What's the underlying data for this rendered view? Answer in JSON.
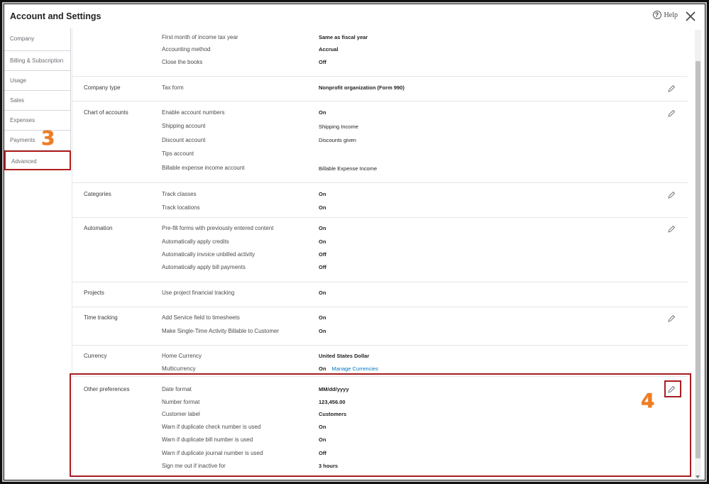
{
  "window": {
    "title": "Account and Settings",
    "help_label": "Help"
  },
  "sidebar": {
    "items": [
      {
        "label": "Company"
      },
      {
        "label": "Billing & Subscription"
      },
      {
        "label": "Usage"
      },
      {
        "label": "Sales"
      },
      {
        "label": "Expenses"
      },
      {
        "label": "Payments"
      },
      {
        "label": "Advanced",
        "selected": true
      }
    ]
  },
  "annotations": {
    "step3": "3",
    "step4": "4"
  },
  "sections": {
    "accounting": {
      "rows": [
        {
          "label": "First month of income tax year",
          "value": "Same as fiscal year"
        },
        {
          "label": "Accounting method",
          "value": "Accrual"
        },
        {
          "label": "Close the books",
          "value": "Off"
        }
      ]
    },
    "company_type": {
      "title": "Company type",
      "rows": [
        {
          "label": "Tax form",
          "value": "Nonprofit organization (Form 990)"
        }
      ]
    },
    "chart_of_accounts": {
      "title": "Chart of accounts",
      "rows": [
        {
          "label": "Enable account numbers",
          "value": "On"
        },
        {
          "label": "Shipping account",
          "value": "Shipping Income"
        },
        {
          "label": "Discount account",
          "value": "Discounts given"
        },
        {
          "label": "Tips account",
          "value": ""
        },
        {
          "label": "Billable expense income account",
          "value": "Billable Expense Income"
        }
      ]
    },
    "categories": {
      "title": "Categories",
      "rows": [
        {
          "label": "Track classes",
          "value": "On"
        },
        {
          "label": "Track locations",
          "value": "On"
        }
      ]
    },
    "automation": {
      "title": "Automation",
      "rows": [
        {
          "label": "Pre-fill forms with previously entered content",
          "value": "On"
        },
        {
          "label": "Automatically apply credits",
          "value": "On"
        },
        {
          "label": "Automatically invoice unbilled activity",
          "value": "Off"
        },
        {
          "label": "Automatically apply bill payments",
          "value": "Off"
        }
      ]
    },
    "projects": {
      "title": "Projects",
      "rows": [
        {
          "label": "Use project financial tracking",
          "value": "On"
        }
      ]
    },
    "time_tracking": {
      "title": "Time tracking",
      "rows": [
        {
          "label": "Add Service field to timesheets",
          "value": "On"
        },
        {
          "label": "Make Single-Time Activity Billable to Customer",
          "value": "On"
        }
      ]
    },
    "currency": {
      "title": "Currency",
      "rows": [
        {
          "label": "Home Currency",
          "value": "United States Dollar"
        },
        {
          "label": "Multicurrency",
          "value": "On",
          "link": "Manage Currencies"
        }
      ]
    },
    "other_preferences": {
      "title": "Other preferences",
      "rows": [
        {
          "label": "Date format",
          "value": "MM/dd/yyyy"
        },
        {
          "label": "Number format",
          "value": "123,456.00"
        },
        {
          "label": "Customer label",
          "value": "Customers"
        },
        {
          "label": "Warn if duplicate check number is used",
          "value": "On"
        },
        {
          "label": "Warn if duplicate bill number is used",
          "value": "On"
        },
        {
          "label": "Warn if duplicate journal number is used",
          "value": "Off"
        },
        {
          "label": "Sign me out if inactive for",
          "value": "3 hours"
        }
      ]
    }
  },
  "colors": {
    "highlight": "#a51e22",
    "annotation": "#f07c22",
    "link": "#0077c5"
  }
}
